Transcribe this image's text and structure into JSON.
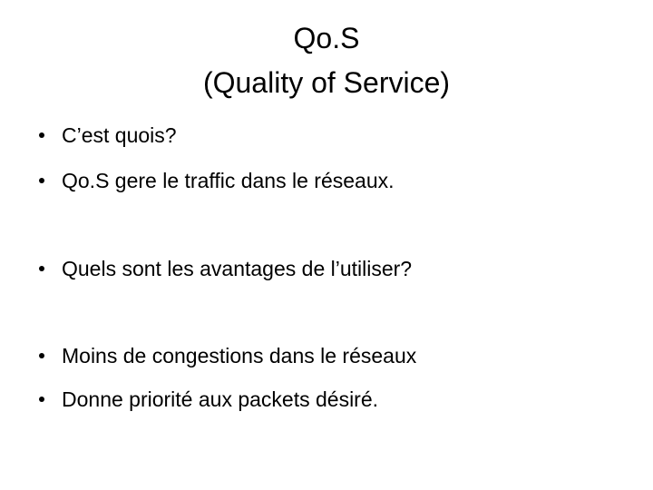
{
  "slide": {
    "title_line1": "Qo.S",
    "title_line2": "(Quality of Service)",
    "bullets": [
      "C’est quois?",
      "Qo.S gere  le traffic dans le réseaux.",
      "Quels sont les avantages de l’utiliser?",
      "Moins de congestions dans le réseaux",
      "Donne priorité aux packets désiré."
    ]
  }
}
